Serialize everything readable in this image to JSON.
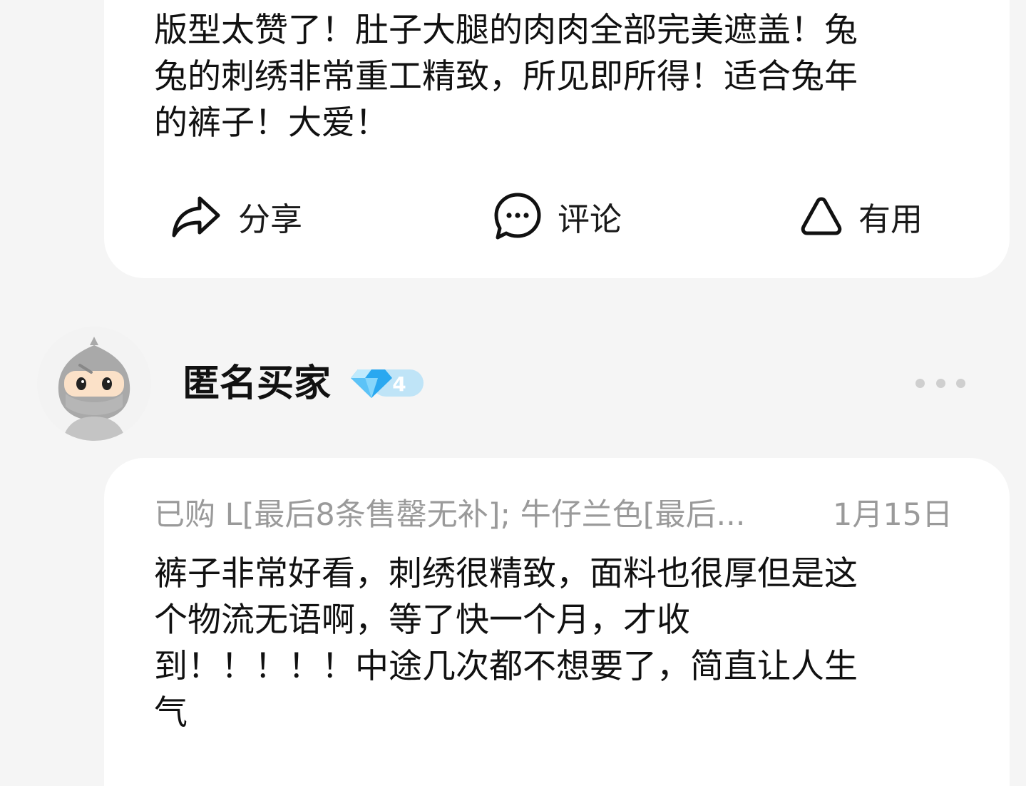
{
  "review1": {
    "text": "版型太赞了！肚子大腿的肉肉全部完美遮盖！兔\n兔的刺绣非常重工精致，所见即所得！适合兔年\n的裤子！大爱！"
  },
  "actions": {
    "share_label": "分享",
    "comment_label": "评论",
    "useful_label": "有用"
  },
  "review2": {
    "username": "匿名买家",
    "level": "4",
    "sku": "已购 L[最后8条售罄无补]; 牛仔兰色[最后...",
    "date": "1月15日",
    "text": "裤子非常好看，刺绣很精致，面料也很厚但是这\n个物流无语啊，等了快一个月，才收\n到！！！！！中途几次都不想要了，简直让人生\n气"
  },
  "colors": {
    "background": "#f5f5f5",
    "card": "#ffffff",
    "muted_text": "#9a9a9a",
    "badge_blue": "#5fbdf0"
  },
  "icons": [
    "share-icon",
    "comment-icon",
    "thumb-up-outline-icon",
    "diamond-icon",
    "more-dots-icon"
  ]
}
